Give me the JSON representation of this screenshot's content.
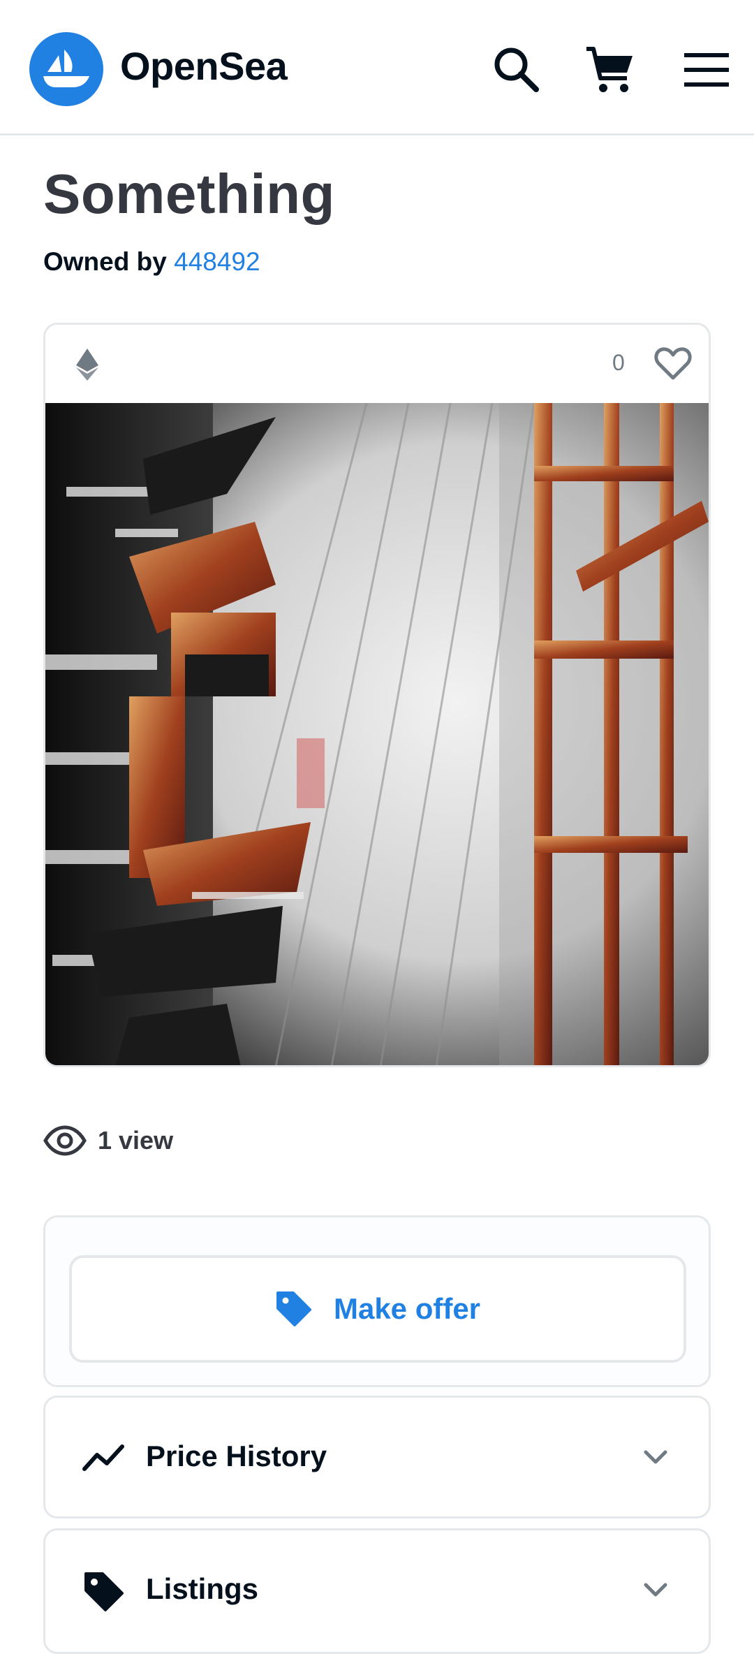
{
  "header": {
    "brand": "OpenSea",
    "icons": [
      "opensea-logo-icon",
      "search-icon",
      "cart-icon",
      "menu-icon"
    ]
  },
  "item": {
    "title": "Something",
    "owned_by_label": "Owned by",
    "owner": "448492",
    "favorites_count": "0",
    "chain_icon": "ethereum-icon",
    "views_label": "1 view"
  },
  "actions": {
    "make_offer_label": "Make offer"
  },
  "sections": {
    "price_history_label": "Price History",
    "listings_label": "Listings"
  },
  "colors": {
    "accent": "#2081e2",
    "text": "#04111d",
    "muted": "#707a83",
    "border": "#e5e8eb"
  }
}
